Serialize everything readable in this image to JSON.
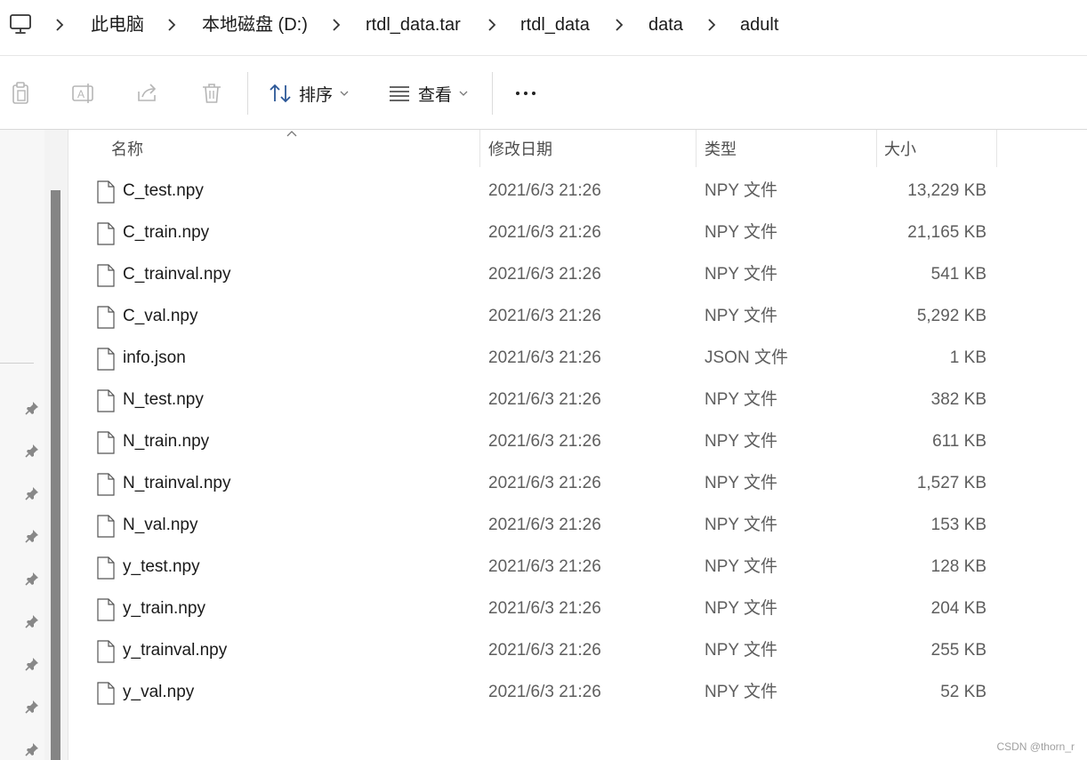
{
  "breadcrumb": {
    "items": [
      "此电脑",
      "本地磁盘 (D:)",
      "rtdl_data.tar",
      "rtdl_data",
      "data",
      "adult"
    ]
  },
  "toolbar": {
    "sort_label": "排序",
    "view_label": "查看",
    "icons": [
      "copy-icon",
      "rename-icon",
      "share-icon",
      "delete-icon",
      "sort-icon",
      "view-icon",
      "more-icon"
    ]
  },
  "columns": {
    "name": "名称",
    "date": "修改日期",
    "type": "类型",
    "size": "大小"
  },
  "files": [
    {
      "name": "C_test.npy",
      "date": "2021/6/3 21:26",
      "type": "NPY 文件",
      "size": "13,229 KB"
    },
    {
      "name": "C_train.npy",
      "date": "2021/6/3 21:26",
      "type": "NPY 文件",
      "size": "21,165 KB"
    },
    {
      "name": "C_trainval.npy",
      "date": "2021/6/3 21:26",
      "type": "NPY 文件",
      "size": "541 KB"
    },
    {
      "name": "C_val.npy",
      "date": "2021/6/3 21:26",
      "type": "NPY 文件",
      "size": "5,292 KB"
    },
    {
      "name": "info.json",
      "date": "2021/6/3 21:26",
      "type": "JSON 文件",
      "size": "1 KB"
    },
    {
      "name": "N_test.npy",
      "date": "2021/6/3 21:26",
      "type": "NPY 文件",
      "size": "382 KB"
    },
    {
      "name": "N_train.npy",
      "date": "2021/6/3 21:26",
      "type": "NPY 文件",
      "size": "611 KB"
    },
    {
      "name": "N_trainval.npy",
      "date": "2021/6/3 21:26",
      "type": "NPY 文件",
      "size": "1,527 KB"
    },
    {
      "name": "N_val.npy",
      "date": "2021/6/3 21:26",
      "type": "NPY 文件",
      "size": "153 KB"
    },
    {
      "name": "y_test.npy",
      "date": "2021/6/3 21:26",
      "type": "NPY 文件",
      "size": "128 KB"
    },
    {
      "name": "y_train.npy",
      "date": "2021/6/3 21:26",
      "type": "NPY 文件",
      "size": "204 KB"
    },
    {
      "name": "y_trainval.npy",
      "date": "2021/6/3 21:26",
      "type": "NPY 文件",
      "size": "255 KB"
    },
    {
      "name": "y_val.npy",
      "date": "2021/6/3 21:26",
      "type": "NPY 文件",
      "size": "52 KB"
    }
  ],
  "watermark": "CSDN @thorn_r",
  "colors": {
    "text": "#1a1a1a",
    "muted_text": "#5e5e5e",
    "accent": "#3a7bd5",
    "scroll_thumb": "#858585"
  }
}
